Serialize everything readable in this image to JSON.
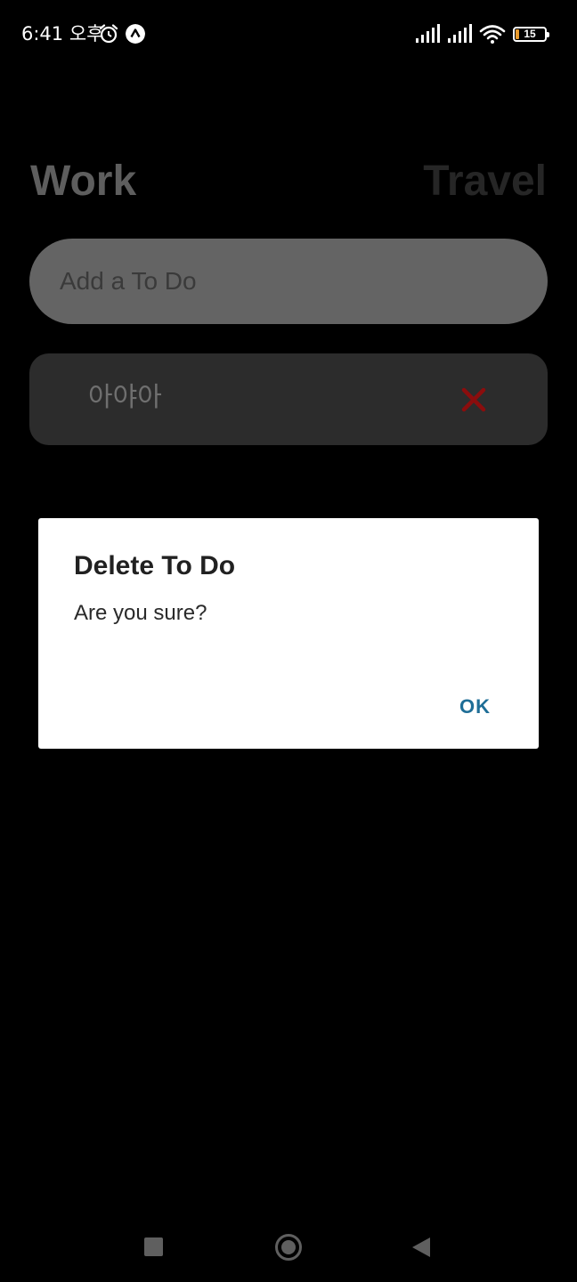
{
  "status_bar": {
    "time": "6:41 오후",
    "battery_level": "15",
    "icons": [
      "alarm-icon",
      "app-notification-icon",
      "signal-icon",
      "signal-icon",
      "wifi-icon",
      "battery-icon"
    ]
  },
  "tabs": {
    "work_label": "Work",
    "travel_label": "Travel",
    "active": "Work"
  },
  "input": {
    "placeholder": "Add a To Do",
    "value": ""
  },
  "todos": [
    {
      "text": "아야아",
      "delete_icon": "close-icon"
    }
  ],
  "dialog": {
    "title": "Delete To Do",
    "message": "Are you sure?",
    "ok_label": "OK"
  },
  "colors": {
    "background": "#000000",
    "input_bg": "#646464",
    "item_bg": "#2c2c2c",
    "delete_red": "#8b0d0d",
    "ok_blue": "#1f6e97"
  }
}
